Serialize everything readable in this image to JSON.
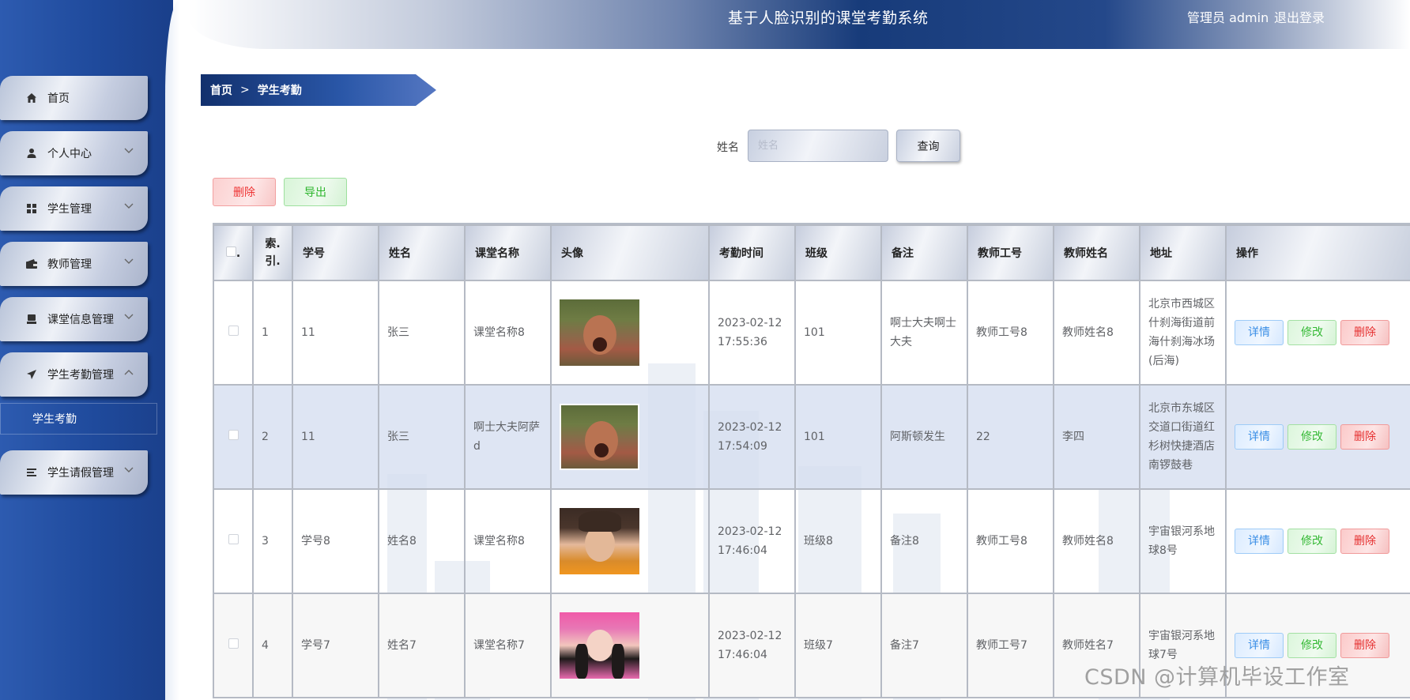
{
  "header": {
    "title": "基于人脸识别的课堂考勤系统",
    "user_label": "管理员 admin",
    "logout_label": "退出登录"
  },
  "sidebar": {
    "items": [
      {
        "label": "首页",
        "icon": "home-icon",
        "expandable": false
      },
      {
        "label": "个人中心",
        "icon": "user-icon",
        "expandable": true
      },
      {
        "label": "学生管理",
        "icon": "grid-icon",
        "expandable": true
      },
      {
        "label": "教师管理",
        "icon": "wallet-icon",
        "expandable": true
      },
      {
        "label": "课堂信息管理",
        "icon": "monitor-icon",
        "expandable": true
      },
      {
        "label": "学生考勤管理",
        "icon": "send-icon",
        "expandable": true,
        "expanded": true
      },
      {
        "label": "学生请假管理",
        "icon": "list-icon",
        "expandable": true
      }
    ],
    "submenu": {
      "label": "学生考勤"
    }
  },
  "breadcrumb": {
    "home": "首页",
    "separator": ">",
    "current": "学生考勤"
  },
  "search": {
    "label": "姓名",
    "placeholder": "姓名",
    "button": "查询"
  },
  "actions": {
    "delete": "删除",
    "export": "导出"
  },
  "table": {
    "columns": [
      ".",
      "索引",
      "学号",
      "姓名",
      "课堂名称",
      "头像",
      "考勤时间",
      "班级",
      "备注",
      "教师工号",
      "教师姓名",
      "地址",
      "操作"
    ],
    "index_header_line1": "索.",
    "index_header_line2": "引.",
    "op_labels": {
      "detail": "详情",
      "edit": "修改",
      "delete": "删除"
    },
    "rows": [
      {
        "index": "1",
        "student_no": "11",
        "name": "张三",
        "course": "课堂名称8",
        "avatar": "soldier-photo",
        "time_date": "2023-02-12",
        "time_clock": "17:55:36",
        "class": "101",
        "remark": "啊士大夫啊士大夫",
        "teacher_no": "教师工号8",
        "teacher_name": "教师姓名8",
        "address": "北京市西城区什刹海街道前海什刹海冰场(后海)"
      },
      {
        "index": "2",
        "student_no": "11",
        "name": "张三",
        "course": "啊士大夫阿萨d",
        "avatar": "soldier-photo",
        "time_date": "2023-02-12",
        "time_clock": "17:54:09",
        "class": "101",
        "remark": "阿斯顿发生",
        "teacher_no": "22",
        "teacher_name": "李四",
        "address": "北京市东城区交道口街道红杉树快捷酒店南锣鼓巷"
      },
      {
        "index": "3",
        "student_no": "学号8",
        "name": "姓名8",
        "course": "课堂名称8",
        "avatar": "boy-photo",
        "time_date": "2023-02-12",
        "time_clock": "17:46:04",
        "class": "班级8",
        "remark": "备注8",
        "teacher_no": "教师工号8",
        "teacher_name": "教师姓名8",
        "address": "宇宙银河系地球8号"
      },
      {
        "index": "4",
        "student_no": "学号7",
        "name": "姓名7",
        "course": "课堂名称7",
        "avatar": "girl-photo",
        "time_date": "2023-02-12",
        "time_clock": "17:46:04",
        "class": "班级7",
        "remark": "备注7",
        "teacher_no": "教师工号7",
        "teacher_name": "教师姓名7",
        "address": "宇宙银河系地球7号"
      }
    ]
  },
  "watermark": "CSDN @计算机毕设工作室",
  "colors": {
    "sidebar": "#1f4a9c",
    "header_dark": "#173b7a",
    "detail": "#3a8ee6",
    "edit": "#35b935",
    "delete": "#e52e2e"
  }
}
